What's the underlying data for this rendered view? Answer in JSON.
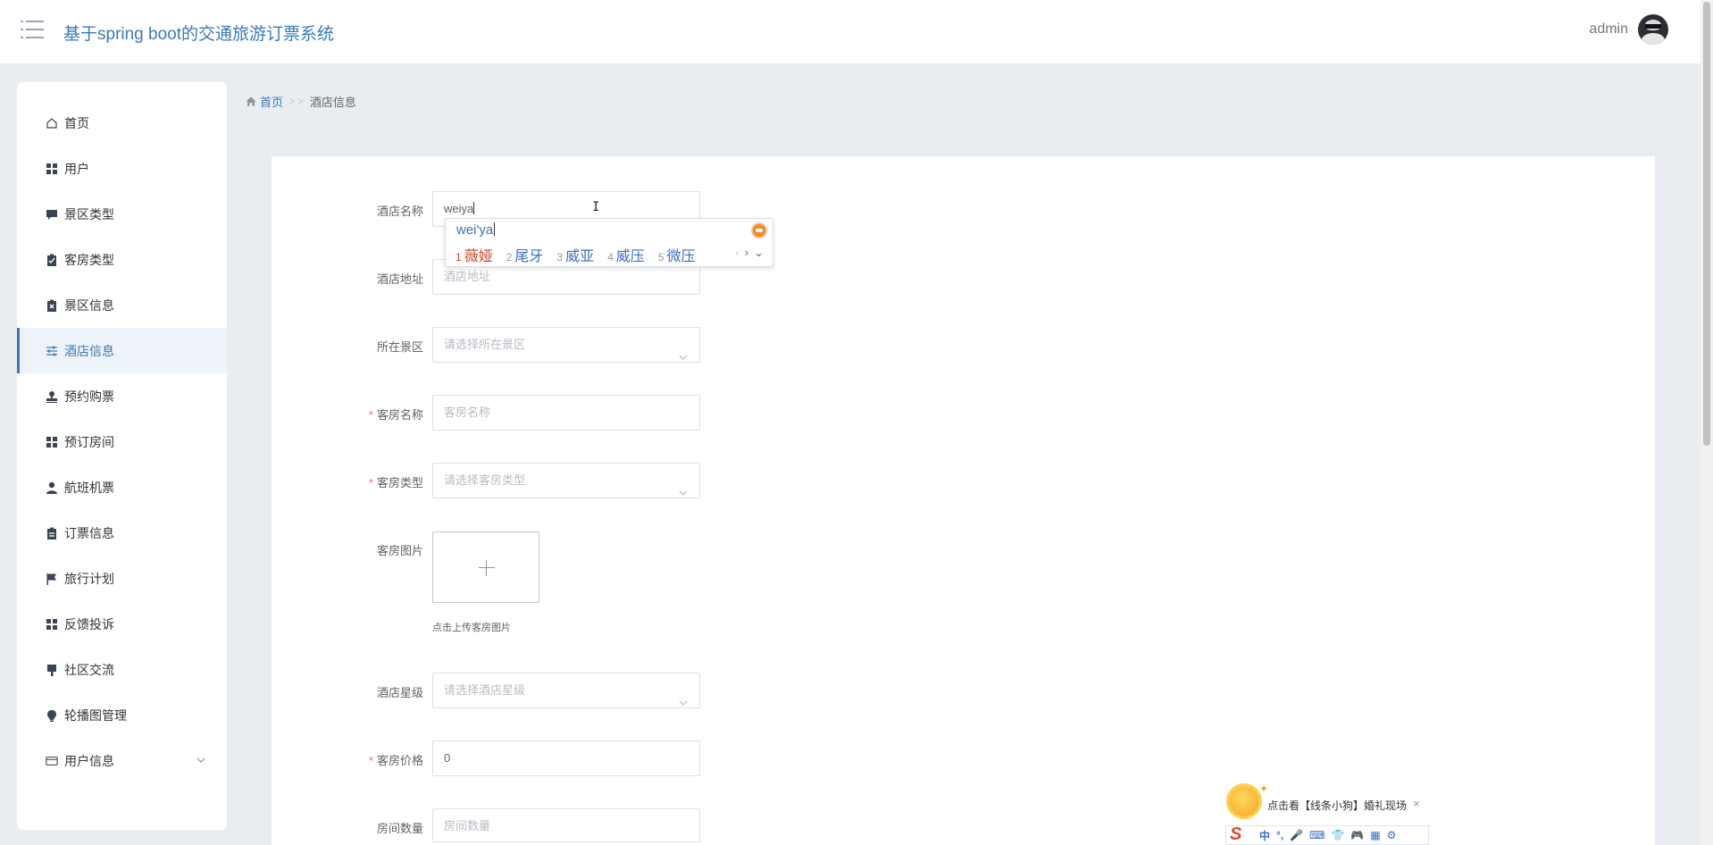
{
  "header": {
    "app_title": "基于spring boot的交通旅游订票系统",
    "user_name": "admin"
  },
  "sidebar": {
    "items": [
      {
        "label": "首页",
        "icon": "home-icon"
      },
      {
        "label": "用户",
        "icon": "grid-icon"
      },
      {
        "label": "景区类型",
        "icon": "comment-icon"
      },
      {
        "label": "客房类型",
        "icon": "clipboard-check-icon"
      },
      {
        "label": "景区信息",
        "icon": "clipboard-x-icon"
      },
      {
        "label": "酒店信息",
        "icon": "sliders-icon",
        "active": true
      },
      {
        "label": "预约购票",
        "icon": "stamp-icon"
      },
      {
        "label": "预订房间",
        "icon": "grid-icon"
      },
      {
        "label": "航班机票",
        "icon": "person-icon"
      },
      {
        "label": "订票信息",
        "icon": "clipboard-icon"
      },
      {
        "label": "旅行计划",
        "icon": "flag-icon"
      },
      {
        "label": "反馈投诉",
        "icon": "grid-icon"
      },
      {
        "label": "社区交流",
        "icon": "brush-icon"
      },
      {
        "label": "轮播图管理",
        "icon": "bulb-icon"
      },
      {
        "label": "用户信息",
        "icon": "card-icon",
        "expandable": true
      }
    ]
  },
  "breadcrumb": {
    "home": "首页",
    "separator": "> >",
    "current": "酒店信息"
  },
  "form": {
    "hotel_name": {
      "label": "酒店名称",
      "value": "weiya"
    },
    "hotel_address": {
      "label": "酒店地址",
      "placeholder": "酒店地址"
    },
    "scenic_area": {
      "label": "所在景区",
      "placeholder": "请选择所在景区"
    },
    "room_name": {
      "label": "客房名称",
      "placeholder": "客房名称",
      "required": true
    },
    "room_type": {
      "label": "客房类型",
      "placeholder": "请选择客房类型",
      "required": true
    },
    "room_image": {
      "label": "客房图片",
      "hint": "点击上传客房图片"
    },
    "hotel_star": {
      "label": "酒店星级",
      "placeholder": "请选择酒店星级"
    },
    "room_price": {
      "label": "客房价格",
      "value": "0",
      "required": true
    },
    "room_count": {
      "label": "房间数量",
      "placeholder": "房间数量"
    }
  },
  "ime": {
    "pinyin": "wei'ya",
    "candidates": [
      {
        "num": "1",
        "text": "薇娅"
      },
      {
        "num": "2",
        "text": "尾牙"
      },
      {
        "num": "3",
        "text": "威亚"
      },
      {
        "num": "4",
        "text": "威压"
      },
      {
        "num": "5",
        "text": "微压"
      }
    ]
  },
  "ad_popup": {
    "text": "点击看【线条小狗】婚礼现场",
    "close": "×"
  },
  "ime_toolbar": {
    "logo": "S",
    "items": [
      "中",
      "°,",
      "🎤",
      "⌨",
      "👕",
      "🎮",
      "▦",
      "⚙"
    ]
  },
  "colors": {
    "accent": "#3a7ab8",
    "required": "#f56c6c",
    "background": "#e9ecf1",
    "ime_highlight": "#d0432b"
  }
}
